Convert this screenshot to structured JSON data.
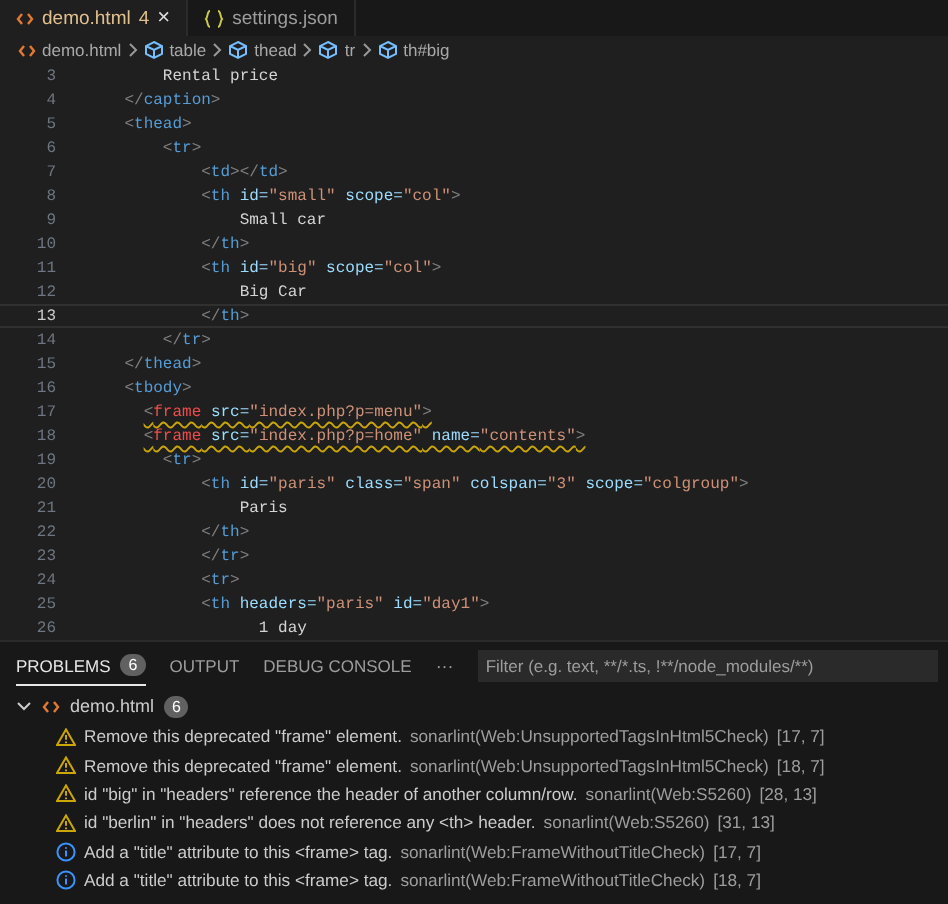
{
  "tabs": [
    {
      "label": "demo.html",
      "badge": "4",
      "selected": true,
      "close": "×"
    },
    {
      "label": "settings.json",
      "selected": false
    }
  ],
  "breadcrumb": [
    "demo.html",
    "table",
    "thead",
    "tr",
    "th#big"
  ],
  "code_lines": [
    {
      "number": "3",
      "current": false,
      "squiggle": false,
      "tokens": [
        {
          "kind": "text",
          "text": "        Rental price"
        }
      ]
    },
    {
      "number": "4",
      "current": false,
      "squiggle": false,
      "tokens": [
        {
          "kind": "punct",
          "text": "    </"
        },
        {
          "kind": "tag",
          "text": "caption"
        },
        {
          "kind": "punct",
          "text": ">"
        }
      ]
    },
    {
      "number": "5",
      "current": false,
      "squiggle": false,
      "tokens": [
        {
          "kind": "punct",
          "text": "    <"
        },
        {
          "kind": "tag",
          "text": "thead"
        },
        {
          "kind": "punct",
          "text": ">"
        }
      ]
    },
    {
      "number": "6",
      "current": false,
      "squiggle": false,
      "tokens": [
        {
          "kind": "punct",
          "text": "        <"
        },
        {
          "kind": "tag",
          "text": "tr"
        },
        {
          "kind": "punct",
          "text": ">"
        }
      ]
    },
    {
      "number": "7",
      "current": false,
      "squiggle": false,
      "tokens": [
        {
          "kind": "punct",
          "text": "            <"
        },
        {
          "kind": "tag",
          "text": "td"
        },
        {
          "kind": "punct",
          "text": "></"
        },
        {
          "kind": "tag",
          "text": "td"
        },
        {
          "kind": "punct",
          "text": ">"
        }
      ]
    },
    {
      "number": "8",
      "current": false,
      "squiggle": false,
      "tokens": [
        {
          "kind": "punct",
          "text": "            <"
        },
        {
          "kind": "tag",
          "text": "th"
        },
        {
          "kind": "attr",
          "text": " id="
        },
        {
          "kind": "string",
          "text": "\"small\""
        },
        {
          "kind": "attr",
          "text": " scope="
        },
        {
          "kind": "string",
          "text": "\"col\""
        },
        {
          "kind": "punct",
          "text": ">"
        }
      ]
    },
    {
      "number": "9",
      "current": false,
      "squiggle": false,
      "tokens": [
        {
          "kind": "text",
          "text": "                Small car"
        }
      ]
    },
    {
      "number": "10",
      "current": false,
      "squiggle": false,
      "tokens": [
        {
          "kind": "punct",
          "text": "            </"
        },
        {
          "kind": "tag",
          "text": "th"
        },
        {
          "kind": "punct",
          "text": ">"
        }
      ]
    },
    {
      "number": "11",
      "current": false,
      "squiggle": false,
      "tokens": [
        {
          "kind": "punct",
          "text": "            <"
        },
        {
          "kind": "tag",
          "text": "th"
        },
        {
          "kind": "attr",
          "text": " id="
        },
        {
          "kind": "string",
          "text": "\"big\""
        },
        {
          "kind": "attr",
          "text": " scope="
        },
        {
          "kind": "string",
          "text": "\"col\""
        },
        {
          "kind": "punct",
          "text": ">"
        }
      ]
    },
    {
      "number": "12",
      "current": false,
      "squiggle": false,
      "tokens": [
        {
          "kind": "text",
          "text": "                Big Car"
        }
      ]
    },
    {
      "number": "13",
      "current": true,
      "squiggle": false,
      "tokens": [
        {
          "kind": "punct",
          "text": "            </"
        },
        {
          "kind": "tag",
          "text": "th"
        },
        {
          "kind": "punct",
          "text": ">"
        }
      ]
    },
    {
      "number": "14",
      "current": false,
      "squiggle": false,
      "tokens": [
        {
          "kind": "punct",
          "text": "        </"
        },
        {
          "kind": "tag",
          "text": "tr"
        },
        {
          "kind": "punct",
          "text": ">"
        }
      ]
    },
    {
      "number": "15",
      "current": false,
      "squiggle": false,
      "tokens": [
        {
          "kind": "punct",
          "text": "    </"
        },
        {
          "kind": "tag",
          "text": "thead"
        },
        {
          "kind": "punct",
          "text": ">"
        }
      ]
    },
    {
      "number": "16",
      "current": false,
      "squiggle": false,
      "tokens": [
        {
          "kind": "punct",
          "text": "    <"
        },
        {
          "kind": "tag",
          "text": "tbody"
        },
        {
          "kind": "punct",
          "text": ">"
        }
      ]
    },
    {
      "number": "17",
      "current": false,
      "squiggle": true,
      "tokens": [
        {
          "kind": "punct",
          "text": "      <"
        },
        {
          "kind": "deprecated",
          "text": "frame"
        },
        {
          "kind": "attr",
          "text": " src="
        },
        {
          "kind": "string",
          "text": "\"index.php?p=menu\""
        },
        {
          "kind": "punct",
          "text": ">"
        }
      ]
    },
    {
      "number": "18",
      "current": false,
      "squiggle": true,
      "tokens": [
        {
          "kind": "punct",
          "text": "      <"
        },
        {
          "kind": "deprecated",
          "text": "frame"
        },
        {
          "kind": "attr",
          "text": " src="
        },
        {
          "kind": "string",
          "text": "\"index.php?p=home\""
        },
        {
          "kind": "attr",
          "text": " name="
        },
        {
          "kind": "string",
          "text": "\"contents\""
        },
        {
          "kind": "punct",
          "text": ">"
        }
      ]
    },
    {
      "number": "19",
      "current": false,
      "squiggle": false,
      "tokens": [
        {
          "kind": "punct",
          "text": "        <"
        },
        {
          "kind": "tag",
          "text": "tr"
        },
        {
          "kind": "punct",
          "text": ">"
        }
      ]
    },
    {
      "number": "20",
      "current": false,
      "squiggle": false,
      "tokens": [
        {
          "kind": "punct",
          "text": "            <"
        },
        {
          "kind": "tag",
          "text": "th"
        },
        {
          "kind": "attr",
          "text": " id="
        },
        {
          "kind": "string",
          "text": "\"paris\""
        },
        {
          "kind": "attr",
          "text": " class="
        },
        {
          "kind": "string",
          "text": "\"span\""
        },
        {
          "kind": "attr",
          "text": " colspan="
        },
        {
          "kind": "string",
          "text": "\"3\""
        },
        {
          "kind": "attr",
          "text": " scope="
        },
        {
          "kind": "string",
          "text": "\"colgroup\""
        },
        {
          "kind": "punct",
          "text": ">"
        }
      ]
    },
    {
      "number": "21",
      "current": false,
      "squiggle": false,
      "tokens": [
        {
          "kind": "text",
          "text": "                Paris"
        }
      ]
    },
    {
      "number": "22",
      "current": false,
      "squiggle": false,
      "tokens": [
        {
          "kind": "punct",
          "text": "            </"
        },
        {
          "kind": "tag",
          "text": "th"
        },
        {
          "kind": "punct",
          "text": ">"
        }
      ]
    },
    {
      "number": "23",
      "current": false,
      "squiggle": false,
      "tokens": [
        {
          "kind": "punct",
          "text": "            </"
        },
        {
          "kind": "tag",
          "text": "tr"
        },
        {
          "kind": "punct",
          "text": ">"
        }
      ]
    },
    {
      "number": "24",
      "current": false,
      "squiggle": false,
      "tokens": [
        {
          "kind": "punct",
          "text": "            <"
        },
        {
          "kind": "tag",
          "text": "tr"
        },
        {
          "kind": "punct",
          "text": ">"
        }
      ]
    },
    {
      "number": "25",
      "current": false,
      "squiggle": false,
      "tokens": [
        {
          "kind": "punct",
          "text": "            <"
        },
        {
          "kind": "tag",
          "text": "th"
        },
        {
          "kind": "attr",
          "text": " headers="
        },
        {
          "kind": "string",
          "text": "\"paris\""
        },
        {
          "kind": "attr",
          "text": " id="
        },
        {
          "kind": "string",
          "text": "\"day1\""
        },
        {
          "kind": "punct",
          "text": ">"
        }
      ]
    },
    {
      "number": "26",
      "current": false,
      "squiggle": false,
      "tokens": [
        {
          "kind": "text",
          "text": "                  1 day"
        }
      ]
    }
  ],
  "panel": {
    "tabs": [
      {
        "label": "PROBLEMS",
        "badge": "6",
        "selected": true
      },
      {
        "label": "OUTPUT",
        "selected": false
      },
      {
        "label": "DEBUG CONSOLE",
        "selected": false
      }
    ],
    "more": "···",
    "filter_placeholder": "Filter (e.g. text, **/*.ts, !**/node_modules/**)",
    "file": {
      "name": "demo.html",
      "count": "6",
      "expanded": true
    },
    "problems": [
      {
        "kind": "warning",
        "message": "Remove this deprecated \"frame\" element.",
        "source": "sonarlint(Web:UnsupportedTagsInHtml5Check)",
        "position": "[17, 7]"
      },
      {
        "kind": "warning",
        "message": "Remove this deprecated \"frame\" element.",
        "source": "sonarlint(Web:UnsupportedTagsInHtml5Check)",
        "position": "[18, 7]"
      },
      {
        "kind": "warning",
        "message": "id \"big\" in \"headers\" reference the header of another column/row.",
        "source": "sonarlint(Web:S5260)",
        "position": "[28, 13]"
      },
      {
        "kind": "warning",
        "message": "id \"berlin\" in \"headers\" does not reference any <th> header.",
        "source": "sonarlint(Web:S5260)",
        "position": "[31, 13]"
      },
      {
        "kind": "info",
        "message": "Add a \"title\" attribute to this <frame> tag.",
        "source": "sonarlint(Web:FrameWithoutTitleCheck)",
        "position": "[17, 7]"
      },
      {
        "kind": "info",
        "message": "Add a \"title\" attribute to this <frame> tag.",
        "source": "sonarlint(Web:FrameWithoutTitleCheck)",
        "position": "[18, 7]"
      }
    ]
  }
}
